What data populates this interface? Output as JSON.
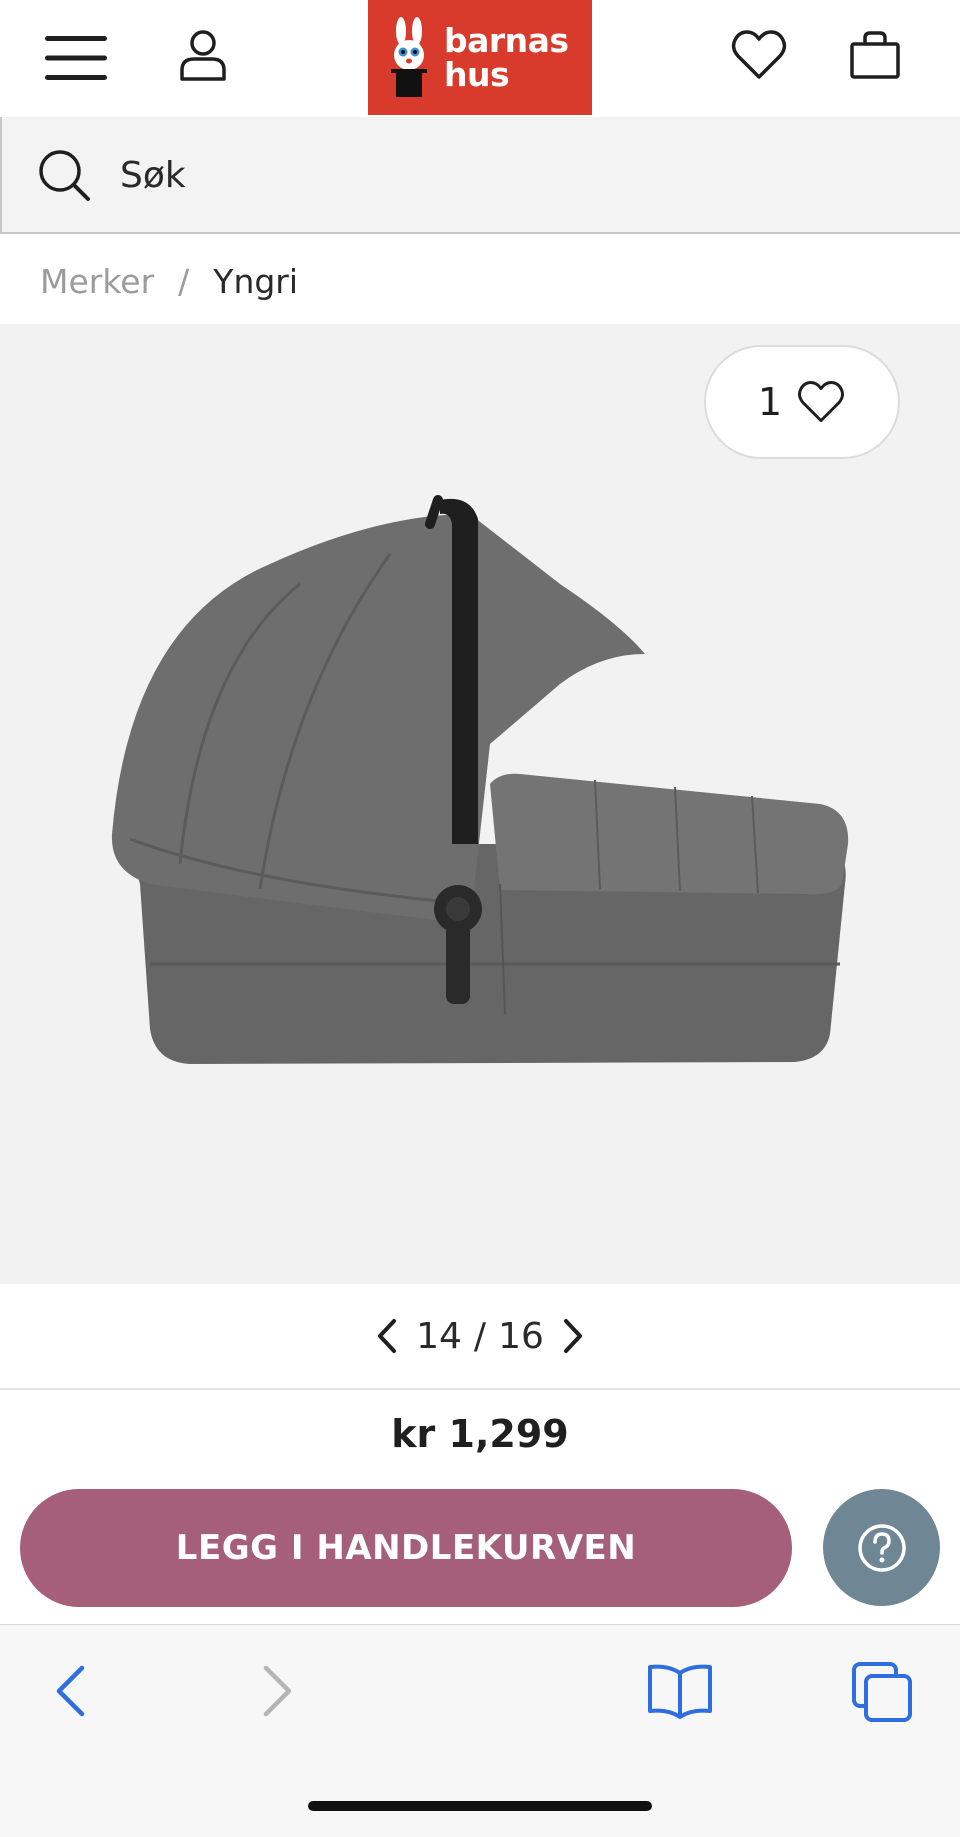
{
  "header": {
    "logo_line1": "barnas",
    "logo_line2": "hus",
    "menu_icon": "hamburger-menu-icon",
    "account_icon": "user-icon",
    "favorites_icon": "heart-icon",
    "cart_icon": "shopping-bag-icon",
    "brand_color": "#d83a2b"
  },
  "search": {
    "placeholder": "Søk",
    "value": ""
  },
  "breadcrumb": {
    "items": [
      "Merker",
      "Yngri"
    ],
    "separator": "/"
  },
  "product": {
    "favorite_count": "1",
    "image_alt": "Grå bærebag med kalesje",
    "pager": {
      "current": "14",
      "separator": "/",
      "total": "16"
    },
    "price": "kr 1,299"
  },
  "actions": {
    "add_to_cart_label": "LEGG I HANDLEKURVEN",
    "add_to_cart_color": "#a55f78",
    "help_icon": "question-circle-icon",
    "help_color": "#6f8795"
  },
  "browser": {
    "back_icon": "chevron-left-icon",
    "forward_icon": "chevron-right-icon",
    "bookmarks_icon": "open-book-icon",
    "tabs_icon": "tabs-icon",
    "accent_color": "#2f6ee0"
  }
}
